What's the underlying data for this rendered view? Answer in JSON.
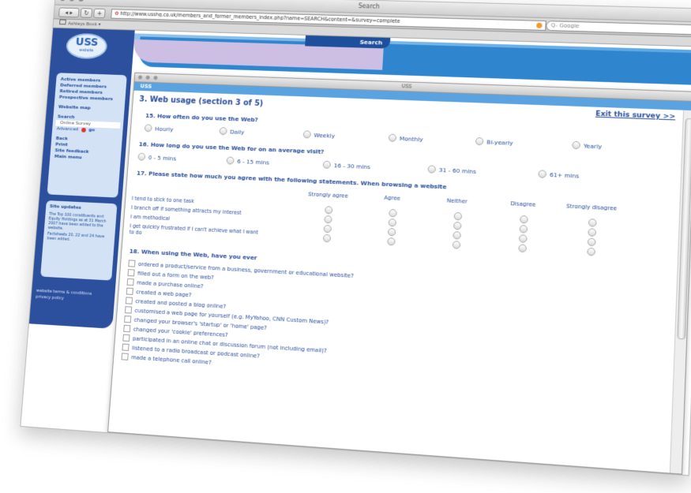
{
  "browser": {
    "window_title": "Search",
    "url": "http://www.usshq.co.uk/members_and_former_members_index.php?name=SEARCH&content=&survey=complete",
    "search_placeholder": "Q- Google",
    "bookmark_label": "Ashleys Book ▾",
    "nav_back": "◂ ▸",
    "nav_reload": "↻",
    "nav_add": "+"
  },
  "site": {
    "logo_text": "USS",
    "logo_sub": "website",
    "search_tab": "Search",
    "sidebar": {
      "members": [
        "Active members",
        "Deferred members",
        "Retired members",
        "Prospective members"
      ],
      "site_map": "Website map",
      "search_items": [
        "Search",
        "Online Survey",
        "Advanced"
      ],
      "go_label": "go",
      "actions": [
        "Back",
        "Print",
        "Site feedback",
        "Main menu"
      ]
    },
    "updates": {
      "heading": "Site updates",
      "p1": "The Top 100 constituents and Equity Holdings as at 31 March 2007 have been added to the website.",
      "p2": "Factsheets 20, 22 and 24 have been added."
    },
    "footer_links": [
      "website terms & conditions",
      "privacy policy"
    ]
  },
  "survey_window": {
    "title": "USS",
    "bar_label": "USS",
    "section_title": "3. Web usage (section 3 of 5)",
    "exit_link": "Exit this survey >>",
    "q15": {
      "title": "15. How often do you use the Web?",
      "options": [
        "Hourly",
        "Daily",
        "Weekly",
        "Monthly",
        "Bi-yearly",
        "Yearly"
      ]
    },
    "q16": {
      "title": "16. How long do you use the Web for on an average visit?",
      "options": [
        "0 - 5 mins",
        "6 - 15 mins",
        "16 - 30 mins",
        "31 - 60 mins",
        "61+ mins"
      ]
    },
    "q17": {
      "title": "17. Please state how much you agree with the following statements. When browsing a website",
      "columns": [
        "Strongly agree",
        "Agree",
        "Neither",
        "Disagree",
        "Strongly disagree"
      ],
      "statements": [
        "I tend to stick to one task",
        "I branch off if something attracts my interest",
        "I am methodical",
        "I get quickly frustrated if I can't achieve what I want",
        "to do"
      ]
    },
    "q18": {
      "title": "18. When using the Web, have you ever",
      "items": [
        "ordered a product/service from a business, government or educational website?",
        "filled out a form on the web?",
        "made a purchase online?",
        "created a web page?",
        "created and posted a blog online?",
        "customised a web page for yourself (e.g. MyYahoo, CNN Custom News)?",
        "changed your browser's 'startup' or 'home' page?",
        "changed your 'cookie' preferences?",
        "participated in an online chat or discussion forum (not including email)?",
        "listened to a radio broadcast or podcast online?",
        "made a telephone call online?"
      ]
    }
  }
}
